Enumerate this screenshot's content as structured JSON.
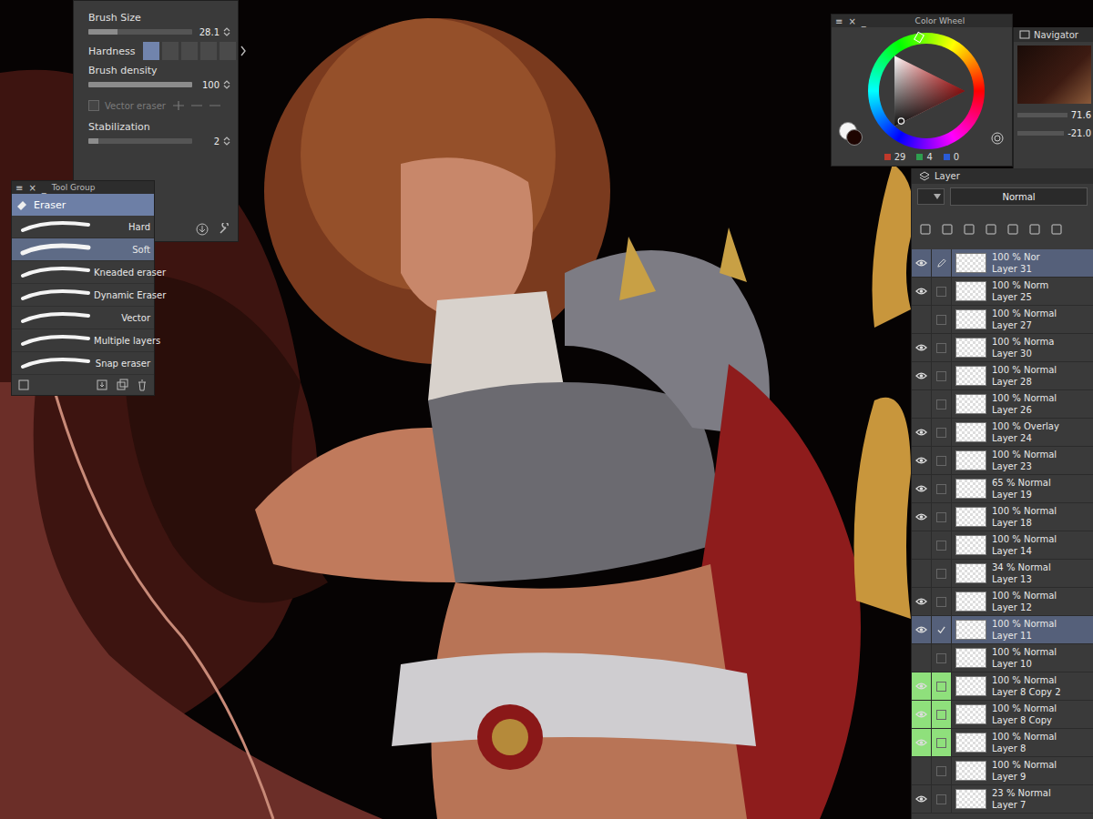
{
  "brush_settings": {
    "items": [
      {
        "kind": "slider",
        "label": "Brush Size",
        "value": "28.1",
        "level": 0.28
      },
      {
        "kind": "steps",
        "label": "Hardness",
        "level": 0.2
      },
      {
        "kind": "slider",
        "label": "Brush density",
        "value": "100",
        "level": 1
      },
      {
        "kind": "checkbox",
        "label": "Vector eraser",
        "checked": false,
        "disabled": true
      },
      {
        "kind": "slider",
        "label": "Stabilization",
        "value": "2",
        "level": 0.1
      }
    ]
  },
  "tool_group": {
    "title": "Tool Group",
    "controls": [
      "≡",
      "×",
      "_"
    ],
    "tool": "Eraser",
    "items": [
      {
        "label": "Hard",
        "selected": false
      },
      {
        "label": "Soft",
        "selected": true
      },
      {
        "label": "Kneaded eraser",
        "selected": false
      },
      {
        "label": "Dynamic Eraser",
        "selected": false
      },
      {
        "label": "Vector",
        "selected": false
      },
      {
        "label": "Multiple layers",
        "selected": false
      },
      {
        "label": "Snap eraser",
        "selected": false
      }
    ]
  },
  "color_wheel": {
    "title": "Color Wheel",
    "controls": [
      "≡",
      "×",
      "_"
    ],
    "channels": [
      {
        "value": "29",
        "color": "#c0392b"
      },
      {
        "value": "4",
        "color": "#2e9e4f"
      },
      {
        "value": "0",
        "color": "#2a5bd7"
      }
    ]
  },
  "navigator": {
    "tab": "Navigator",
    "values": [
      "71.6",
      "-21.0"
    ]
  },
  "layer_panel": {
    "tab": "Layer",
    "blend_mode": "Normal",
    "layers": [
      {
        "mode": "100 % Nor",
        "name": "Layer 31",
        "visible": true,
        "mark": "pencil",
        "selected": true,
        "labeled": false
      },
      {
        "mode": "100 % Norm",
        "name": "Layer 25",
        "visible": true,
        "mark": "none",
        "selected": false,
        "labeled": false
      },
      {
        "mode": "100 % Normal",
        "name": "Layer 27",
        "visible": false,
        "mark": "none",
        "selected": false,
        "labeled": false
      },
      {
        "mode": "100 % Norma",
        "name": "Layer 30",
        "visible": true,
        "mark": "none",
        "selected": false,
        "labeled": false
      },
      {
        "mode": "100 % Normal",
        "name": "Layer 28",
        "visible": true,
        "mark": "none",
        "selected": false,
        "labeled": false
      },
      {
        "mode": "100 % Normal",
        "name": "Layer 26",
        "visible": false,
        "mark": "none",
        "selected": false,
        "labeled": false
      },
      {
        "mode": "100 % Overlay",
        "name": "Layer 24",
        "visible": true,
        "mark": "none",
        "selected": false,
        "labeled": false
      },
      {
        "mode": "100 % Normal",
        "name": "Layer 23",
        "visible": true,
        "mark": "none",
        "selected": false,
        "labeled": false
      },
      {
        "mode": "65 % Normal",
        "name": "Layer 19",
        "visible": true,
        "mark": "none",
        "selected": false,
        "labeled": false
      },
      {
        "mode": "100 % Normal",
        "name": "Layer 18",
        "visible": true,
        "mark": "none",
        "selected": false,
        "labeled": false
      },
      {
        "mode": "100 % Normal",
        "name": "Layer 14",
        "visible": false,
        "mark": "none",
        "selected": false,
        "labeled": false
      },
      {
        "mode": "34 % Normal",
        "name": "Layer 13",
        "visible": false,
        "mark": "none",
        "selected": false,
        "labeled": false
      },
      {
        "mode": "100 % Normal",
        "name": "Layer 12",
        "visible": true,
        "mark": "none",
        "selected": false,
        "labeled": false
      },
      {
        "mode": "100 % Normal",
        "name": "Layer 11",
        "visible": true,
        "mark": "check",
        "selected": true,
        "labeled": false
      },
      {
        "mode": "100 % Normal",
        "name": "Layer 10",
        "visible": false,
        "mark": "none",
        "selected": false,
        "labeled": false
      },
      {
        "mode": "100 % Normal",
        "name": "Layer 8 Copy 2",
        "visible": true,
        "mark": "none",
        "selected": false,
        "labeled": true
      },
      {
        "mode": "100 % Normal",
        "name": "Layer 8 Copy",
        "visible": true,
        "mark": "none",
        "selected": false,
        "labeled": true
      },
      {
        "mode": "100 % Normal",
        "name": "Layer 8",
        "visible": true,
        "mark": "none",
        "selected": false,
        "labeled": true
      },
      {
        "mode": "100 % Normal",
        "name": "Layer 9",
        "visible": false,
        "mark": "none",
        "selected": false,
        "labeled": false
      },
      {
        "mode": "23 % Normal",
        "name": "Layer 7",
        "visible": true,
        "mark": "none",
        "selected": false,
        "labeled": false
      }
    ]
  }
}
